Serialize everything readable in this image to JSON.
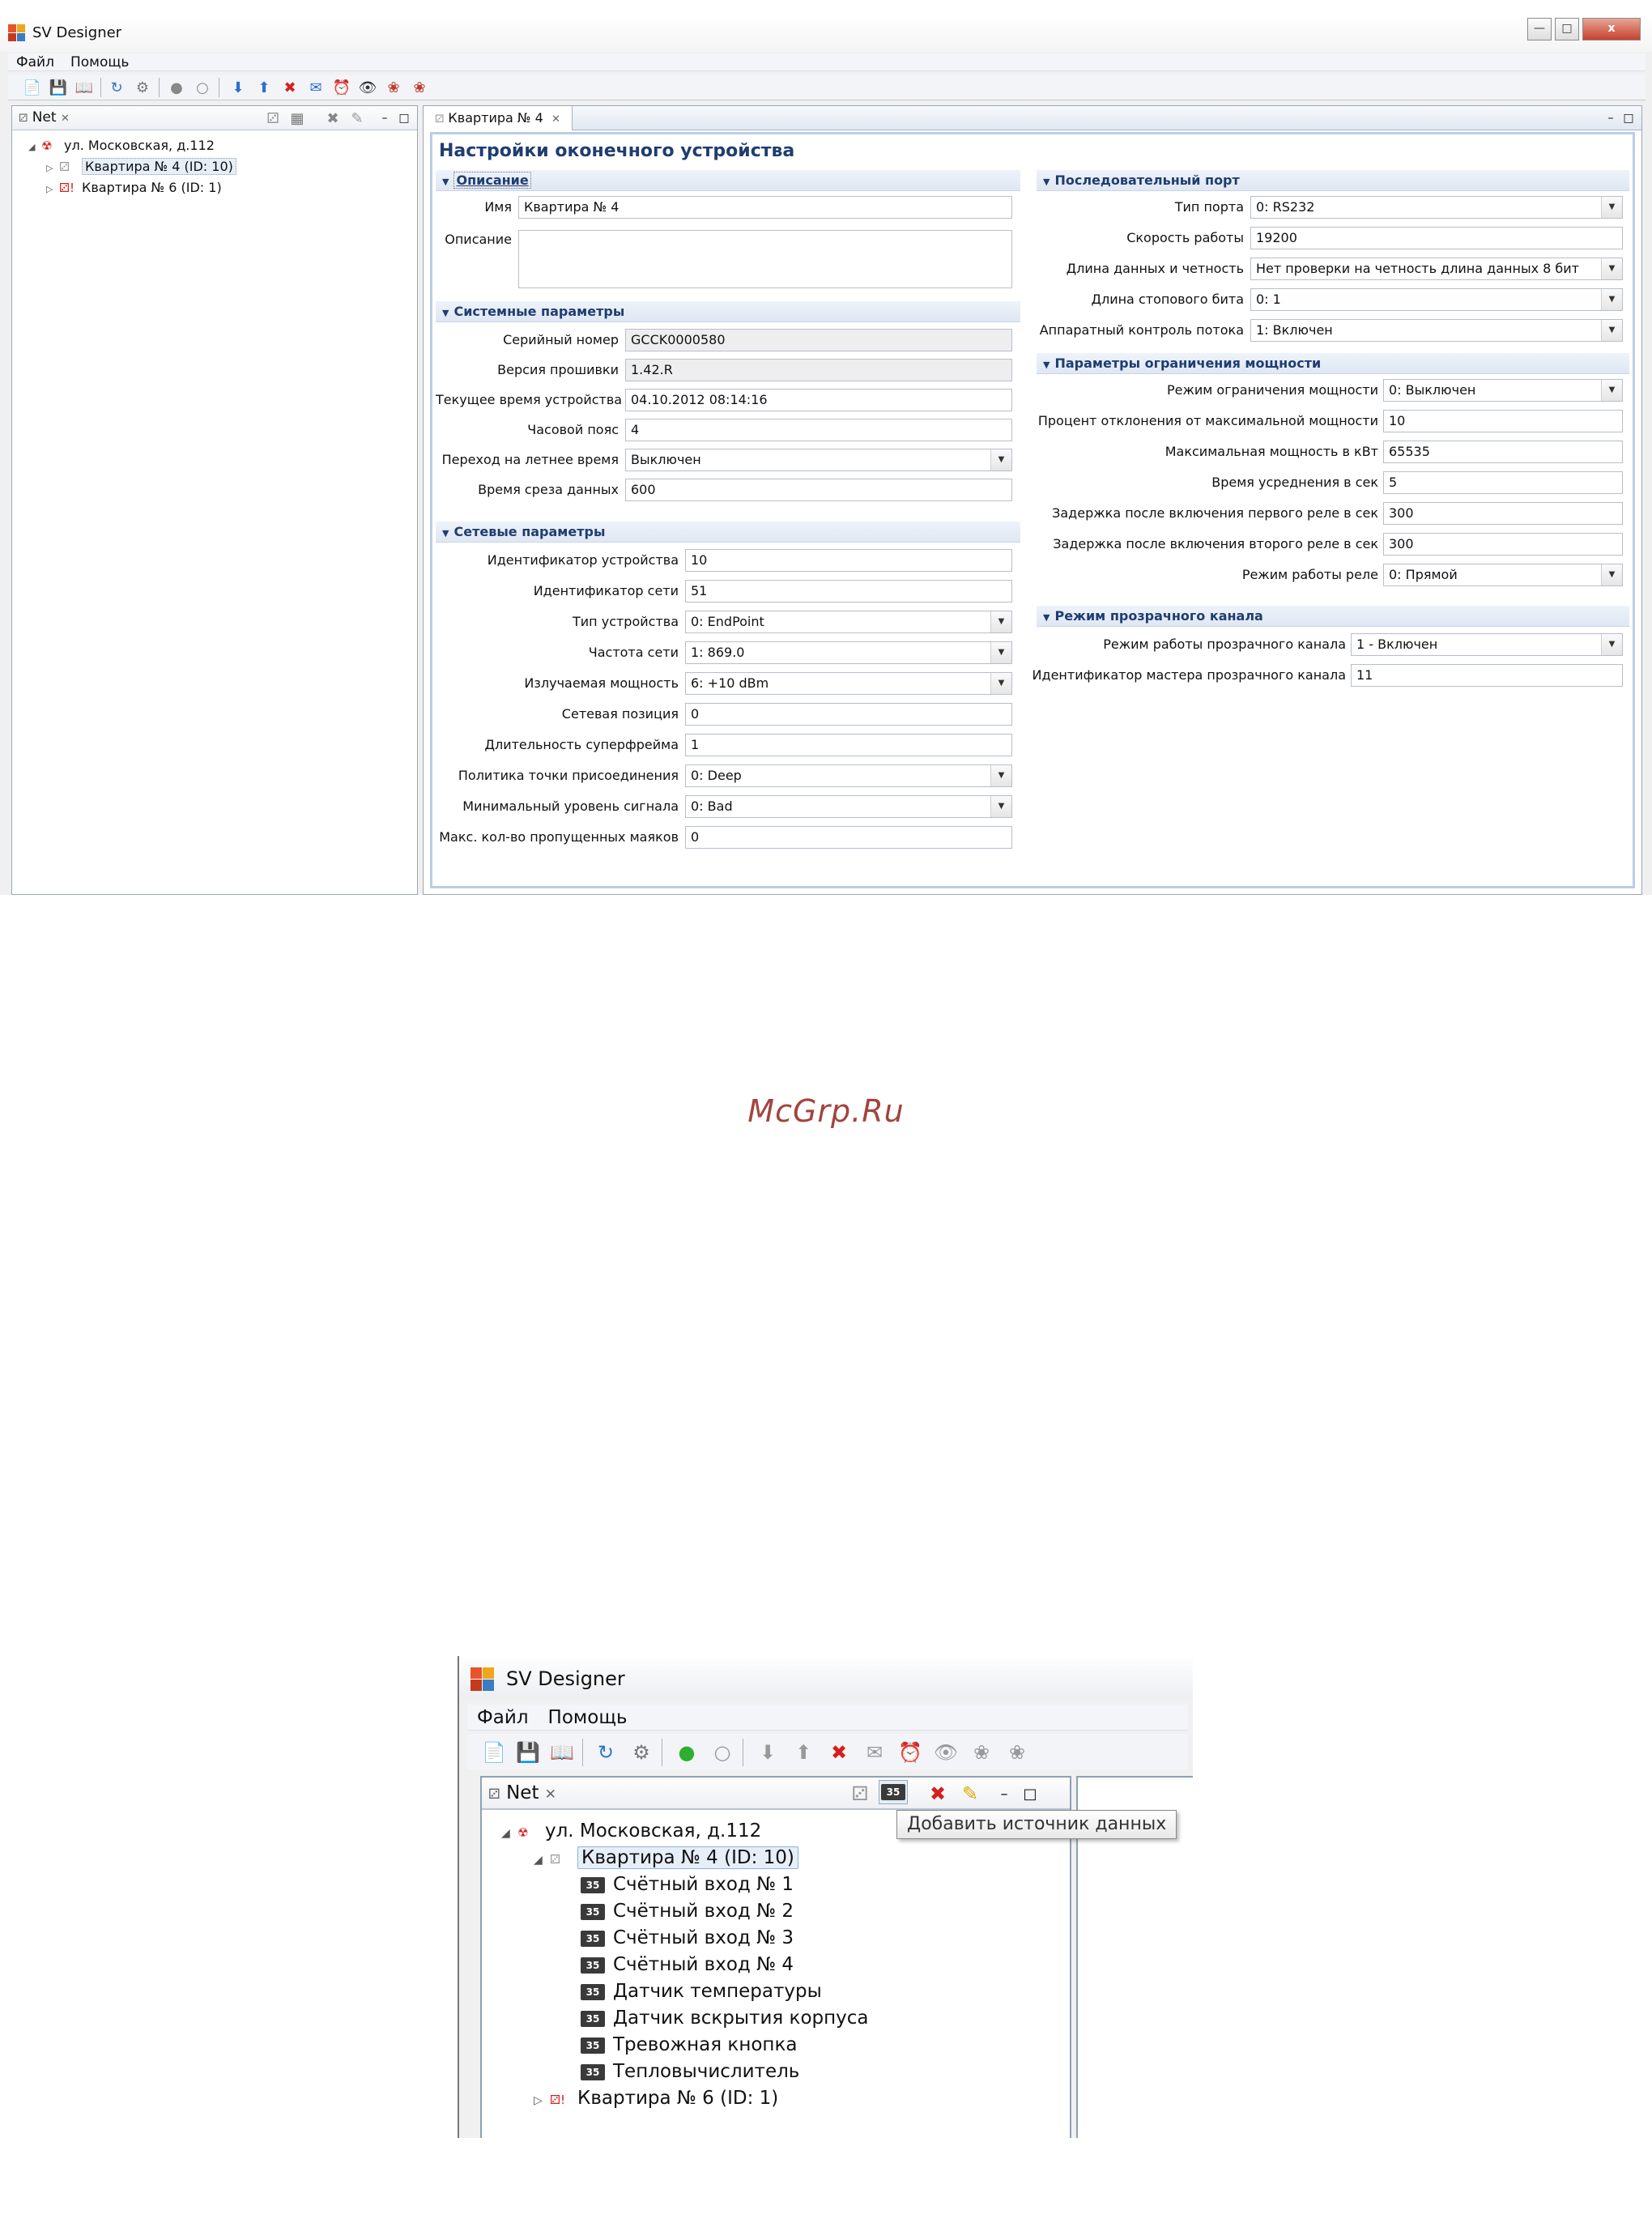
{
  "app": {
    "title": "SV Designer"
  },
  "menu": {
    "file": "Файл",
    "help": "Помощь"
  },
  "window_controls": {
    "close": "x"
  },
  "colors": {
    "section_header": "#1f3d70",
    "accent_border": "#bccde4",
    "error_icon": "#d41f1f",
    "ok_icon": "#2fae2f"
  },
  "panel": {
    "tab_label": "Net"
  },
  "tree": {
    "root": "ул. Московская, д.112",
    "node1": "Квартира № 4 (ID: 10)",
    "node2": "Квартира № 6 (ID: 1)",
    "children": [
      "Счётный вход № 1",
      "Счётный вход № 2",
      "Счётный вход № 3",
      "Счётный вход № 4",
      "Датчик температуры",
      "Датчик вскрытия корпуса",
      "Тревожная кнопка",
      "Тепловычислитель"
    ],
    "data_icon_text": "35"
  },
  "tooltip": "Добавить источник данных",
  "editor": {
    "tab_label": "Квартира № 4",
    "title": "Настройки оконечного устройства",
    "description": {
      "header": "Описание",
      "name_label": "Имя",
      "name_value": "Квартира № 4",
      "desc_label": "Описание",
      "desc_value": ""
    },
    "system": {
      "header": "Системные параметры",
      "serial_label": "Серийный номер",
      "serial_value": "GCCK0000580",
      "firmware_label": "Версия прошивки",
      "firmware_value": "1.42.R",
      "time_label": "Текущее время устройства",
      "time_value": "04.10.2012 08:14:16",
      "tz_label": "Часовой пояс",
      "tz_value": "4",
      "dst_label": "Переход на летнее время",
      "dst_value": "Выключен",
      "cut_label": "Время среза данных",
      "cut_value": "600"
    },
    "network": {
      "header": "Сетевые параметры",
      "dev_id_label": "Идентификатор устройства",
      "dev_id_value": "10",
      "net_id_label": "Идентификатор сети",
      "net_id_value": "51",
      "type_label": "Тип устройства",
      "type_value": "0: EndPoint",
      "freq_label": "Частота сети",
      "freq_value": "1: 869.0",
      "power_label": "Излучаемая мощность",
      "power_value": "6: +10 dBm",
      "pos_label": "Сетевая позиция",
      "pos_value": "0",
      "sf_label": "Длительность суперфрейма",
      "sf_value": "1",
      "policy_label": "Политика точки присоединения",
      "policy_value": "0: Deep",
      "minsig_label": "Минимальный уровень сигнала",
      "minsig_value": "0: Bad",
      "beacons_label": "Макс. кол-во пропущенных маяков",
      "beacons_value": "0"
    },
    "serial": {
      "header": "Последовательный порт",
      "port_label": "Тип порта",
      "port_value": "0: RS232",
      "speed_label": "Скорость работы",
      "speed_value": "19200",
      "data_label": "Длина данных и четность",
      "data_value": "Нет проверки на четность длина данных 8 бит",
      "stop_label": "Длина стопового бита",
      "stop_value": "0: 1",
      "flow_label": "Аппаратный контроль потока",
      "flow_value": "1: Включен"
    },
    "power_limit": {
      "header": "Параметры ограничения мощности",
      "mode_label": "Режим ограничения мощности",
      "mode_value": "0: Выключен",
      "dev_label": "Процент отклонения от максимальной мощности",
      "dev_value": "10",
      "max_label": "Максимальная мощность в кВт",
      "max_value": "65535",
      "avg_label": "Время усреднения в сек",
      "avg_value": "5",
      "delay1_label": "Задержка после включения первого реле в сек",
      "delay1_value": "300",
      "delay2_label": "Задержка после включения второго реле в сек",
      "delay2_value": "300",
      "relay_label": "Режим работы реле",
      "relay_value": "0: Прямой"
    },
    "transparent": {
      "header": "Режим прозрачного канала",
      "mode_label": "Режим работы прозрачного канала",
      "mode_value": "1 - Включен",
      "master_label": "Идентификатор мастера прозрачного канала",
      "master_value": "11"
    }
  },
  "watermark": "McGrp.Ru"
}
